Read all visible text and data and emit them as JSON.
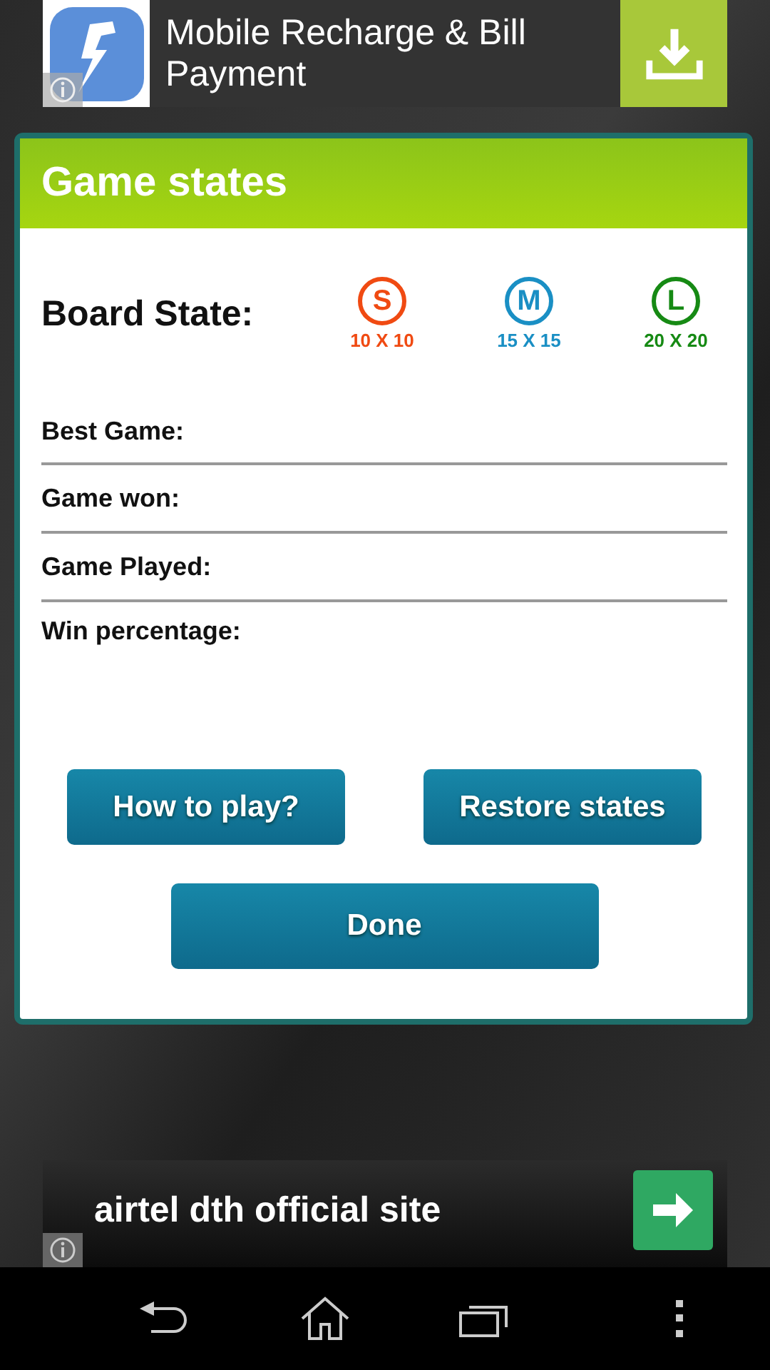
{
  "top_ad": {
    "title": "Mobile Recharge & Bill Payment"
  },
  "dialog": {
    "title": "Game states",
    "board_state": {
      "label": "Board State:",
      "sizes": [
        {
          "letter": "S",
          "size": "10 X 10",
          "color": "#f04a12"
        },
        {
          "letter": "M",
          "size": "15 X 15",
          "color": "#1a8fc4"
        },
        {
          "letter": "L",
          "size": "20 X 20",
          "color": "#168a14"
        }
      ]
    },
    "stats": [
      {
        "label": "Best Game:"
      },
      {
        "label": "Game won:"
      },
      {
        "label": "Game Played:"
      },
      {
        "label": "Win percentage:"
      }
    ],
    "buttons": [
      "How to play?",
      "Restore states"
    ],
    "done_button": "Done"
  },
  "bottom_ad": {
    "title": "airtel dth official site"
  }
}
